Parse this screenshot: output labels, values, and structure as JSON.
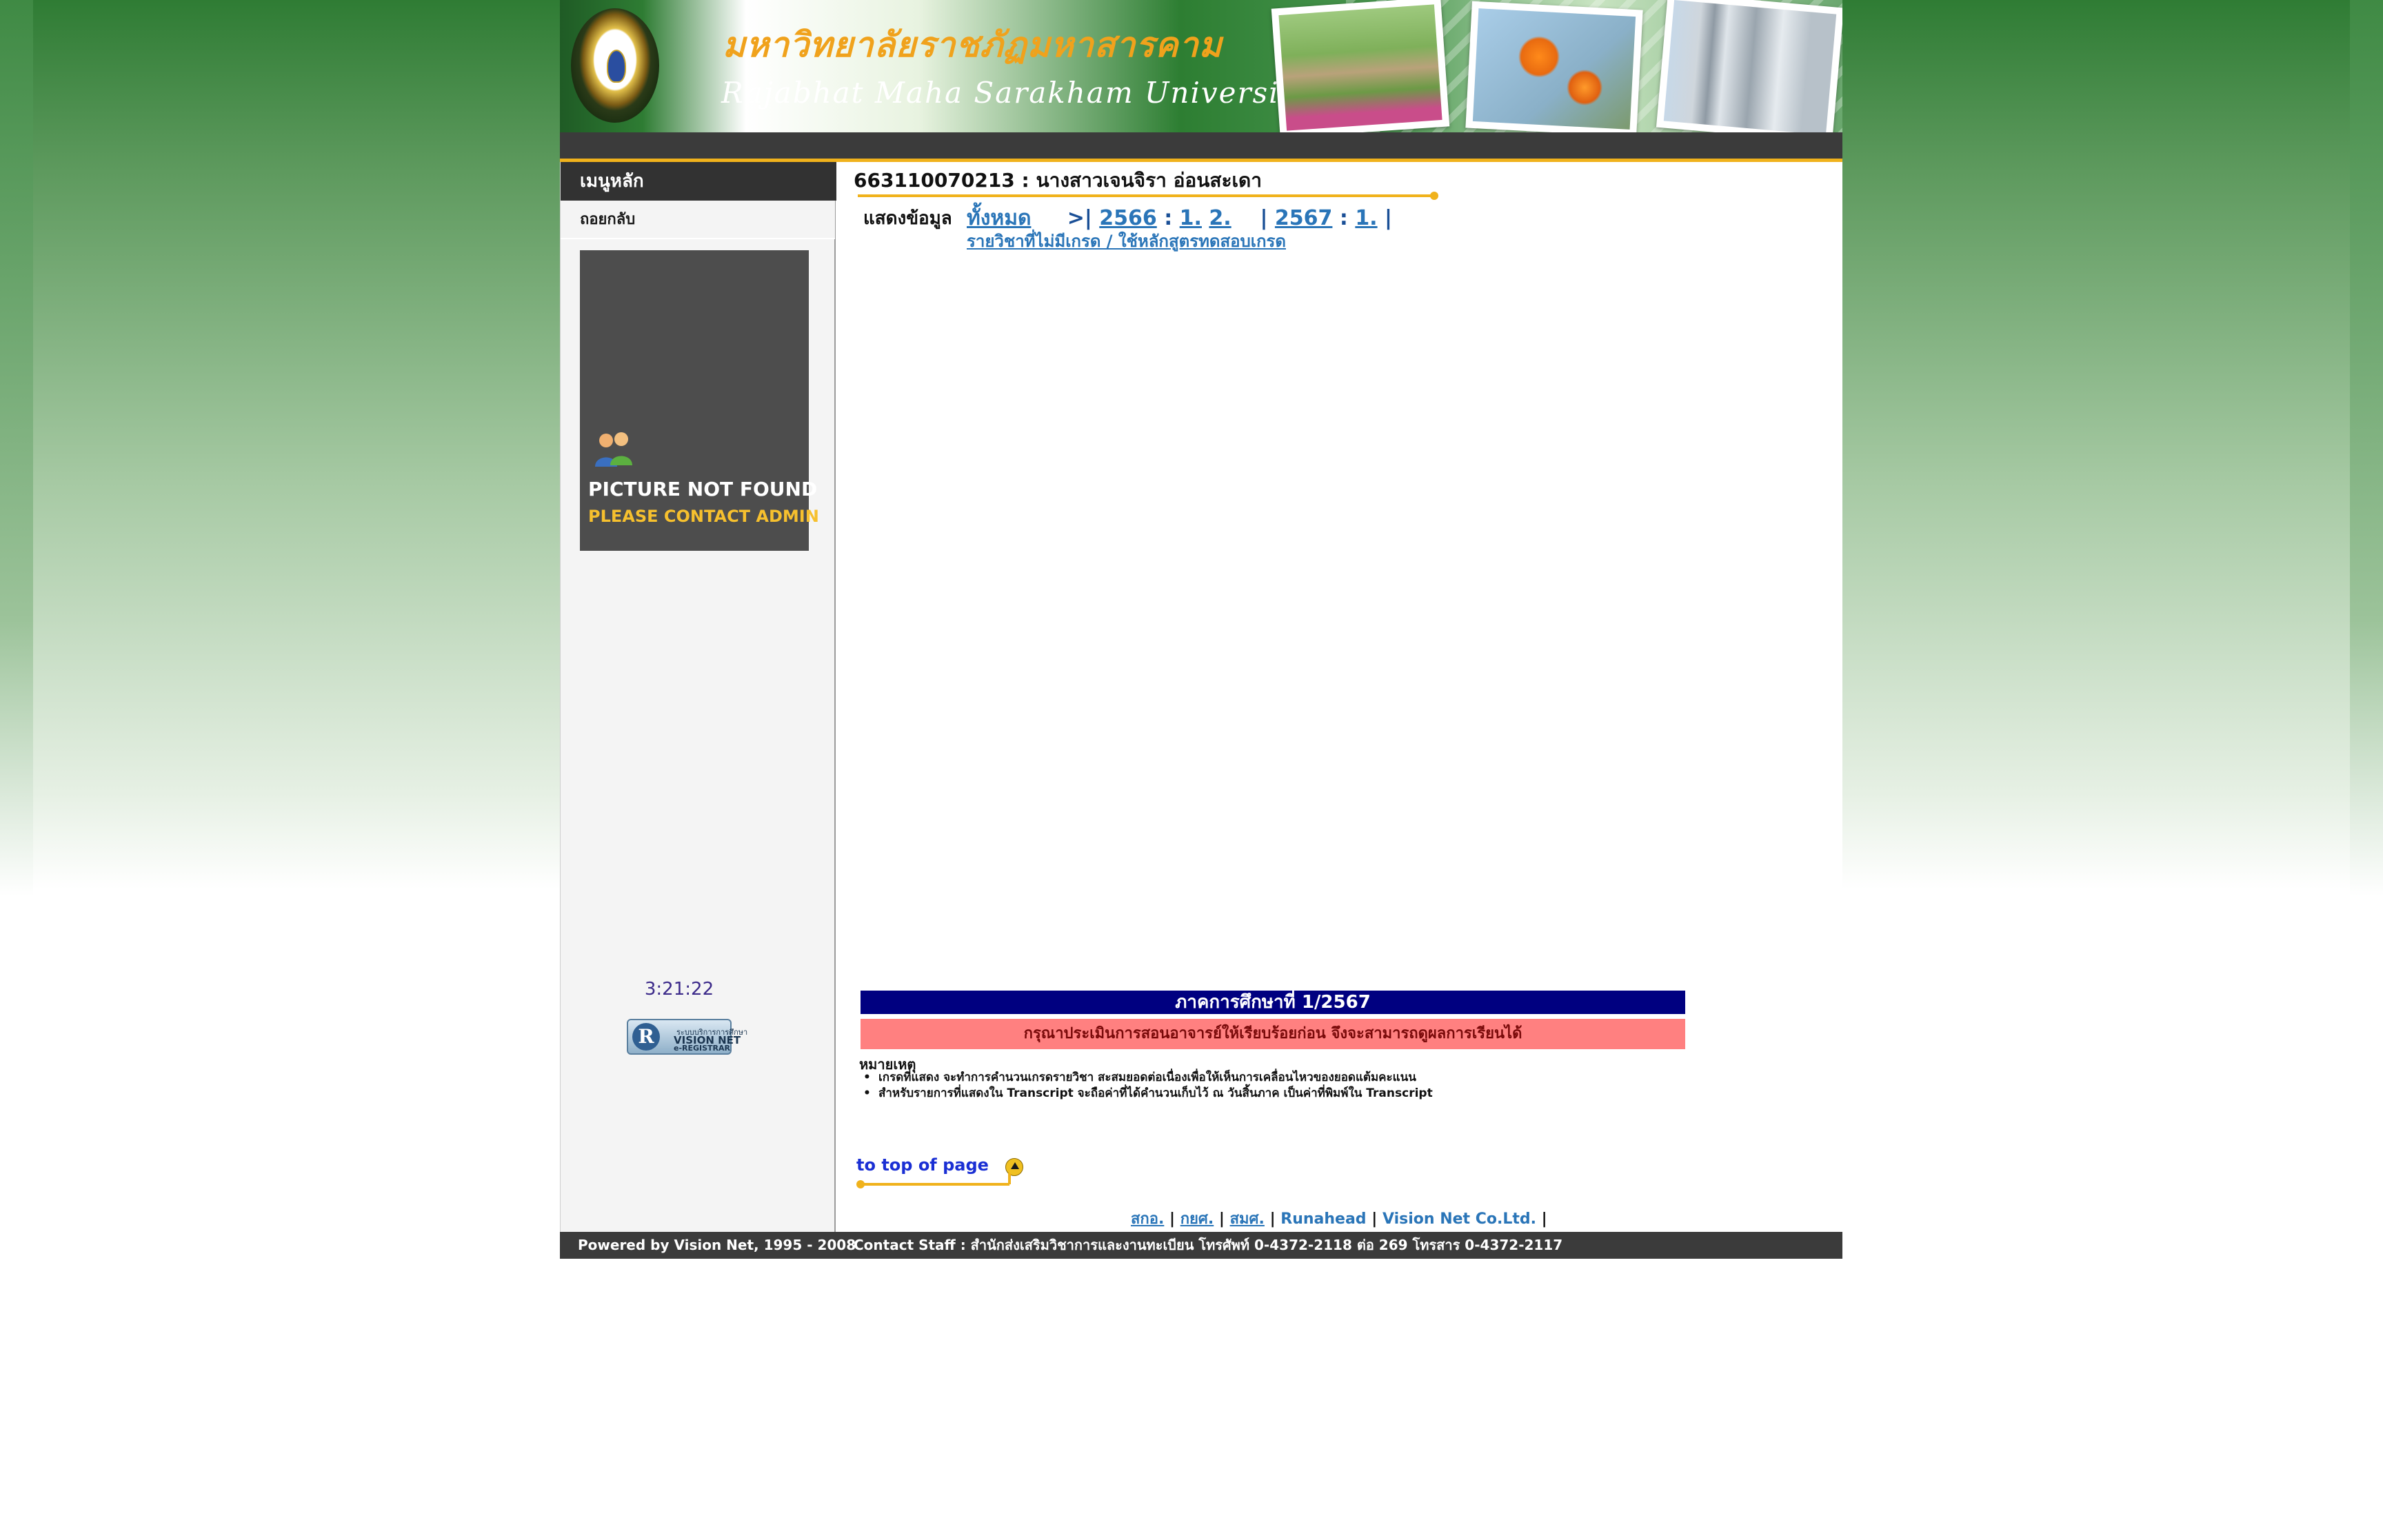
{
  "header": {
    "title_th": "มหาวิทยาลัยราชภัฏมหาสารคาม",
    "title_en": "Rajabhat  Maha Sarakham University"
  },
  "sidebar": {
    "menu_title": "เมนูหลัก",
    "back_label": "ถอยกลับ",
    "photo_placeholder": {
      "line1": "PICTURE NOT FOUND",
      "line2": "PLEASE CONTACT ADMIN"
    },
    "clock": "3:21:22",
    "badge": {
      "letter": "R",
      "line1": "ระบบบริการการศึกษา",
      "line2": "VISION NET",
      "line3": "e-REGISTRAR"
    }
  },
  "main": {
    "student_heading": "663110070213 : นางสาวเจนจิรา อ่อนสะเดา",
    "show_label": "แสดงข้อมูล",
    "filter": {
      "all": "ทั้งหมด",
      "marker": ">|",
      "year1": "2566",
      "year1_terms": [
        "1.",
        "2."
      ],
      "year2": "2567",
      "year2_terms": [
        "1."
      ],
      "colon": ":",
      "bar": "|"
    },
    "no_grade_link": "รายวิชาที่ไม่มีเกรด / ใช้หลักสูตรทดสอบเกรด",
    "term_header": "ภาคการศึกษาที่ 1/2567",
    "warning": "กรุณาประเมินการสอนอาจารย์ให้เรียบร้อยก่อน จึงจะสามารถดูผลการเรียนได้",
    "notes_title": "หมายเหตุ",
    "notes": [
      "เกรดที่แสดง จะทำการคำนวนเกรดรายวิชา สะสมยอดต่อเนื่องเพื่อให้เห็นการเคลื่อนไหวของยอดแต้มคะแนน",
      "สำหรับรายการที่แสดงใน Transcript จะถือค่าที่ได้คำนวนเก็บไว้ ณ วันสิ้นภาค  เป็นค่าที่พิมพ์ใน Transcript"
    ],
    "to_top": "to top of page"
  },
  "footer": {
    "links": [
      "สกอ.",
      "กยศ.",
      "สมศ.",
      "Runahead",
      "Vision Net Co.Ltd."
    ],
    "powered": "Powered by Vision Net, 1995 - 2008",
    "contact": "Contact Staff : สำนักส่งเสริมวิชาการและงานทะเบียน โทรศัพท์ 0-4372-2118 ต่อ 269 โทรสาร 0-4372-2117"
  },
  "colors": {
    "accent_gold": "#f0b21c",
    "term_bar": "#000080",
    "warning_bar": "#ff8080",
    "link_blue": "#2a75b8",
    "dark_bar": "#3b3b3b"
  }
}
